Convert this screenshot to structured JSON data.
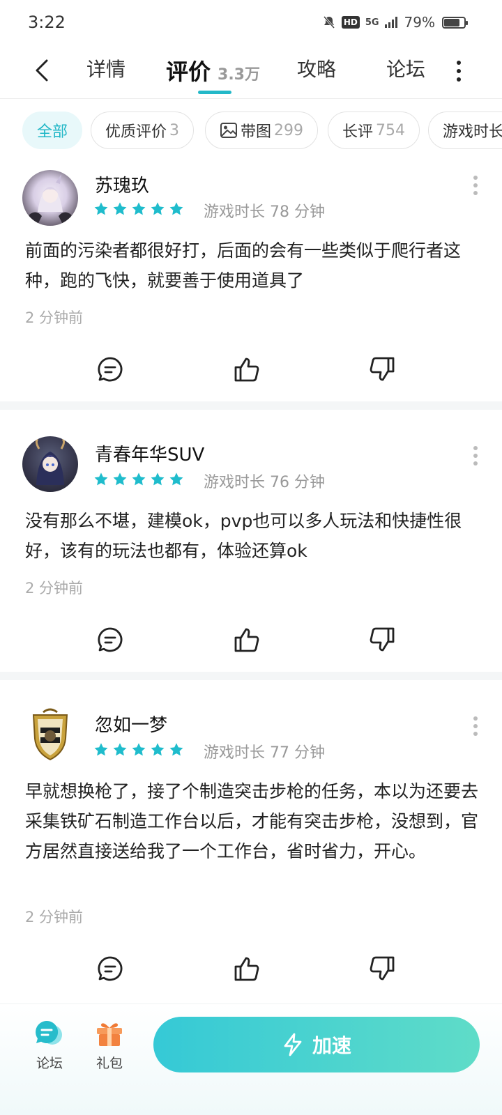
{
  "status": {
    "time": "3:22",
    "network": "5G",
    "battery": "79%",
    "battery_level": 0.79,
    "hd": "HD"
  },
  "nav": {
    "tabs": [
      {
        "label": "详情",
        "count": ""
      },
      {
        "label": "评价",
        "count": "3.3万"
      },
      {
        "label": "攻略",
        "count": ""
      },
      {
        "label": "论坛",
        "count": ""
      }
    ],
    "active_tab": "评价"
  },
  "filters": [
    {
      "label": "全部",
      "count": ""
    },
    {
      "label": "优质评价",
      "count": "3"
    },
    {
      "label": "带图",
      "count": "299"
    },
    {
      "label": "长评",
      "count": "754"
    },
    {
      "label": "游戏时长",
      "count": ""
    }
  ],
  "reviews": [
    {
      "username": "苏瑰玖",
      "rating": 5,
      "playtime": "游戏时长 78 分钟",
      "text": "前面的污染者都很好打，后面的会有一些类似于爬行者这种，跑的飞快，就要善于使用道具了",
      "time": "2 分钟前"
    },
    {
      "username": "青春年华SUV",
      "rating": 5,
      "playtime": "游戏时长 76 分钟",
      "text": "没有那么不堪，建模ok，pvp也可以多人玩法和快捷性很好，该有的玩法也都有，体验还算ok",
      "time": "2 分钟前"
    },
    {
      "username": "忽如一梦",
      "rating": 5,
      "playtime": "游戏时长 77 分钟",
      "text": "早就想换枪了，接了个制造突击步枪的任务，本以为还要去采集铁矿石制造工作台以后，才能有突击步枪，没想到，官方居然直接送给我了一个工作台，省时省力，开心。",
      "time": "2 分钟前"
    }
  ],
  "bottom": {
    "forum_label": "论坛",
    "gift_label": "礼包",
    "boost_label": "加速"
  },
  "colors": {
    "accent": "#23b8c8",
    "star": "#1fbccc",
    "boost_start": "#35c9d6",
    "boost_end": "#5fdcc8"
  },
  "icons": [
    "back-arrow-icon",
    "more-vertical-icon",
    "image-icon",
    "comment-icon",
    "thumbs-up-icon",
    "thumbs-down-icon",
    "forum-chat-icon",
    "gift-icon",
    "lightning-icon"
  ]
}
